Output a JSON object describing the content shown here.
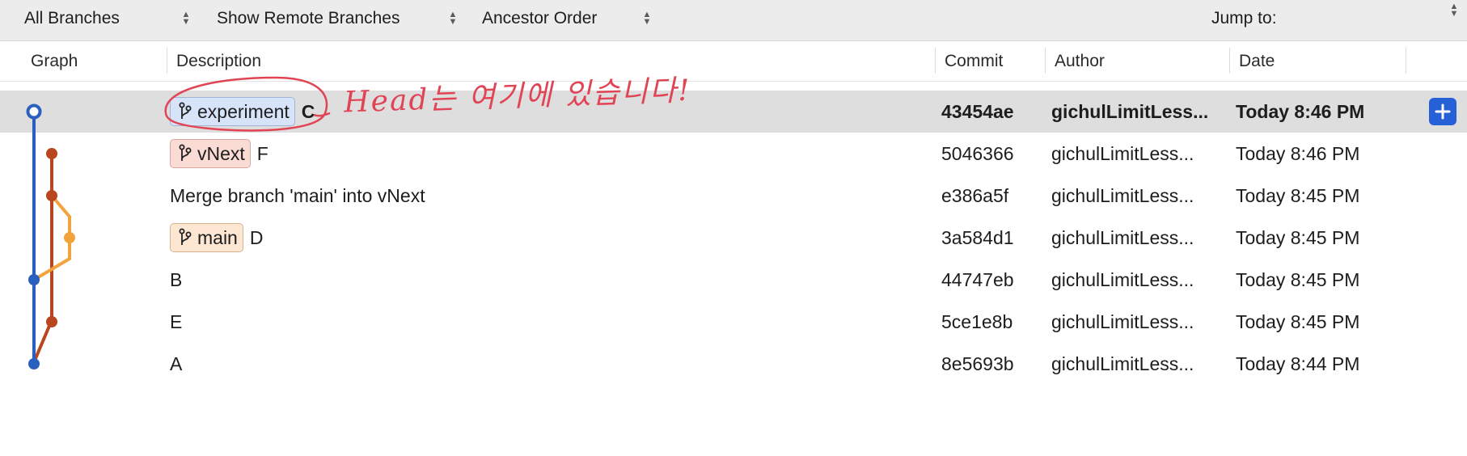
{
  "toolbar": {
    "branches_select": "All Branches",
    "remote_select": "Show Remote Branches",
    "order_select": "Ancestor Order",
    "jump_label": "Jump to:"
  },
  "columns": {
    "graph": "Graph",
    "description": "Description",
    "commit": "Commit",
    "author": "Author",
    "date": "Date"
  },
  "colors": {
    "blue": "#2a5fc0",
    "red": "#b8461f",
    "orange": "#f2a33c",
    "annotation": "#e04455"
  },
  "commits": [
    {
      "branch": "experiment",
      "message": "C",
      "hash": "43454ae",
      "author": "gichulLimitLess...",
      "date": "Today 8:46 PM",
      "selected": true
    },
    {
      "branch": "vNext",
      "message": "F",
      "hash": "5046366",
      "author": "gichulLimitLess...",
      "date": "Today 8:46 PM"
    },
    {
      "branch": "",
      "message": "Merge branch 'main' into vNext",
      "hash": "e386a5f",
      "author": "gichulLimitLess...",
      "date": "Today 8:45 PM"
    },
    {
      "branch": "main",
      "message": "D",
      "hash": "3a584d1",
      "author": "gichulLimitLess...",
      "date": "Today 8:45 PM"
    },
    {
      "branch": "",
      "message": "B",
      "hash": "44747eb",
      "author": "gichulLimitLess...",
      "date": "Today 8:45 PM"
    },
    {
      "branch": "",
      "message": "E",
      "hash": "5ce1e8b",
      "author": "gichulLimitLess...",
      "date": "Today 8:45 PM"
    },
    {
      "branch": "",
      "message": "A",
      "hash": "8e5693b",
      "author": "gichulLimitLess...",
      "date": "Today 8:44 PM"
    }
  ],
  "annotation": {
    "text": "Head는 여기에 있습니다!"
  }
}
